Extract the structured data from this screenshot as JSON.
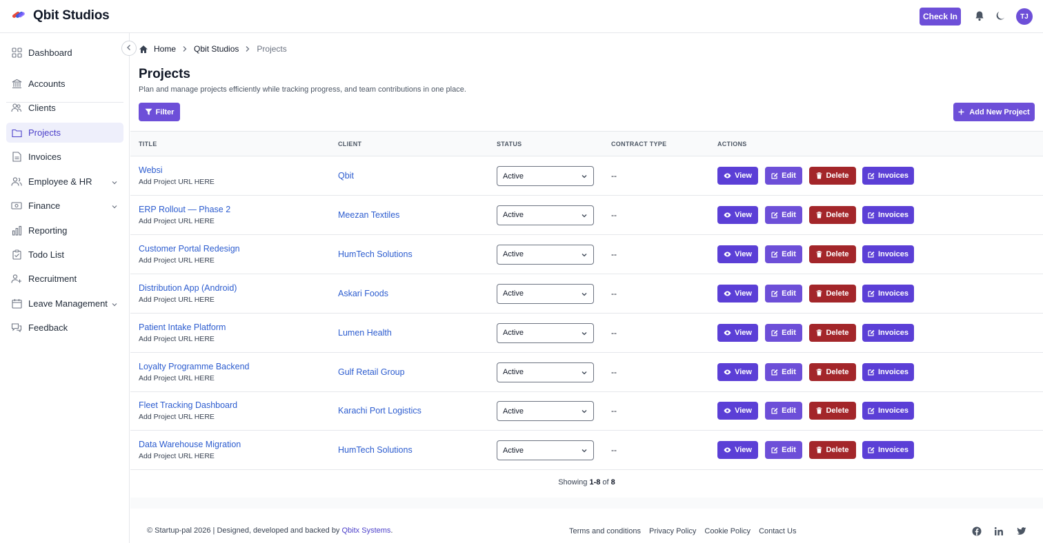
{
  "header": {
    "brand": "Qbit Studios",
    "check_in": "Check In",
    "avatar_initials": "TJ",
    "accent": "#6d4fd8"
  },
  "sidebar": {
    "items": [
      {
        "label": "Dashboard",
        "icon": "dashboard-icon"
      },
      {
        "label": "Accounts",
        "icon": "bank-icon"
      },
      {
        "label": "Clients",
        "icon": "clients-icon"
      },
      {
        "label": "Projects",
        "icon": "folder-icon",
        "active": true
      },
      {
        "label": "Invoices",
        "icon": "invoice-icon"
      },
      {
        "label": "Employee & HR",
        "icon": "users-icon",
        "expandable": true
      },
      {
        "label": "Finance",
        "icon": "money-icon",
        "expandable": true
      },
      {
        "label": "Reporting",
        "icon": "chart-icon"
      },
      {
        "label": "Todo List",
        "icon": "clipboard-icon"
      },
      {
        "label": "Recruitment",
        "icon": "user-plus-icon"
      },
      {
        "label": "Leave Management",
        "icon": "calendar-icon",
        "expandable": true
      },
      {
        "label": "Feedback",
        "icon": "feedback-icon"
      }
    ]
  },
  "breadcrumb": {
    "home": "Home",
    "org": "Qbit Studios",
    "current": "Projects"
  },
  "page": {
    "title": "Projects",
    "subtitle": "Plan and manage projects efficiently while tracking progress, and team contributions in one place.",
    "filter_label": "Filter",
    "add_label": "Add New Project"
  },
  "table": {
    "columns": {
      "title": "TITLE",
      "client": "CLIENT",
      "status": "STATUS",
      "contract": "CONTRACT TYPE",
      "actions": "ACTIONS"
    },
    "action_labels": {
      "view": "View",
      "edit": "Edit",
      "delete": "Delete",
      "invoices": "Invoices"
    },
    "rows": [
      {
        "title": "Websi",
        "url": "Add Project URL HERE",
        "client": "Qbit",
        "status": "Active",
        "contract": "--"
      },
      {
        "title": "ERP Rollout — Phase 2",
        "url": "Add Project URL HERE",
        "client": "Meezan Textiles",
        "status": "Active",
        "contract": "--"
      },
      {
        "title": "Customer Portal Redesign",
        "url": "Add Project URL HERE",
        "client": "HumTech Solutions",
        "status": "Active",
        "contract": "--"
      },
      {
        "title": "Distribution App (Android)",
        "url": "Add Project URL HERE",
        "client": "Askari Foods",
        "status": "Active",
        "contract": "--"
      },
      {
        "title": "Patient Intake Platform",
        "url": "Add Project URL HERE",
        "client": "Lumen Health",
        "status": "Active",
        "contract": "--"
      },
      {
        "title": "Loyalty Programme Backend",
        "url": "Add Project URL HERE",
        "client": "Gulf Retail Group",
        "status": "Active",
        "contract": "--"
      },
      {
        "title": "Fleet Tracking Dashboard",
        "url": "Add Project URL HERE",
        "client": "Karachi Port Logistics",
        "status": "Active",
        "contract": "--"
      },
      {
        "title": "Data Warehouse Migration",
        "url": "Add Project URL HERE",
        "client": "HumTech Solutions",
        "status": "Active",
        "contract": "--"
      }
    ]
  },
  "pagination": {
    "prefix": "Showing",
    "range": "1-8",
    "of": "of",
    "total": "8"
  },
  "footer": {
    "copyright": "© Startup-pal 2026 | Designed, developed and backed by",
    "company": "Qbitx Systems",
    "period": ".",
    "links": [
      "Terms and conditions",
      "Privacy Policy",
      "Cookie Policy",
      "Contact Us"
    ]
  }
}
